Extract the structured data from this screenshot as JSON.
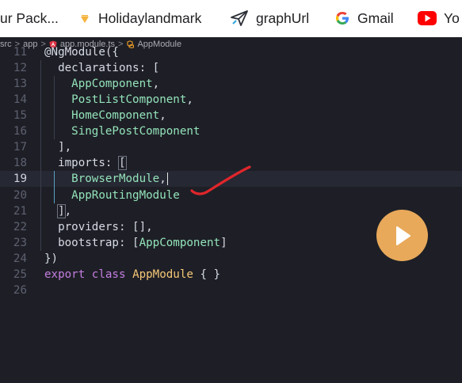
{
  "bookmarks": [
    {
      "label": "ur Pack...",
      "icon": "bookmark-fragment"
    },
    {
      "label": "Holidaylandmark",
      "icon": "holidaylandmark-icon"
    },
    {
      "label": "graphUrl",
      "icon": "paper-plane-icon"
    },
    {
      "label": "Gmail",
      "icon": "google-icon"
    },
    {
      "label": "Yo",
      "icon": "youtube-icon"
    }
  ],
  "breadcrumb": [
    "src",
    "app",
    "app.module.ts",
    "AppModule"
  ],
  "lines": [
    {
      "n": "11",
      "t": [
        [
          "prop",
          "@NgModule({"
        ]
      ]
    },
    {
      "n": "12",
      "t": [
        [
          "prop",
          "  declarations: ["
        ]
      ]
    },
    {
      "n": "13",
      "t": [
        [
          "prop",
          "    "
        ],
        [
          "cls",
          "AppComponent"
        ],
        [
          "prop",
          ","
        ]
      ]
    },
    {
      "n": "14",
      "t": [
        [
          "prop",
          "    "
        ],
        [
          "cls",
          "PostListComponent"
        ],
        [
          "prop",
          ","
        ]
      ]
    },
    {
      "n": "15",
      "t": [
        [
          "prop",
          "    "
        ],
        [
          "cls",
          "HomeComponent"
        ],
        [
          "prop",
          ","
        ]
      ]
    },
    {
      "n": "16",
      "t": [
        [
          "prop",
          "    "
        ],
        [
          "cls",
          "SinglePostComponent"
        ]
      ]
    },
    {
      "n": "17",
      "t": [
        [
          "prop",
          "  ],"
        ]
      ]
    },
    {
      "n": "18",
      "t": [
        [
          "prop",
          "  imports: "
        ],
        [
          "brh",
          "["
        ]
      ]
    },
    {
      "n": "19",
      "t": [
        [
          "prop",
          "    "
        ],
        [
          "cls",
          "BrowserModule"
        ],
        [
          "prop",
          ","
        ],
        [
          "caret",
          ""
        ]
      ]
    },
    {
      "n": "20",
      "t": [
        [
          "prop",
          "    "
        ],
        [
          "cls",
          "AppRoutingModule"
        ]
      ]
    },
    {
      "n": "21",
      "t": [
        [
          "prop",
          "  "
        ],
        [
          "brh",
          "]"
        ],
        [
          "prop",
          ","
        ]
      ]
    },
    {
      "n": "22",
      "t": [
        [
          "prop",
          "  providers: [],"
        ]
      ]
    },
    {
      "n": "23",
      "t": [
        [
          "prop",
          "  bootstrap: ["
        ],
        [
          "cls",
          "AppComponent"
        ],
        [
          "prop",
          "]"
        ]
      ]
    },
    {
      "n": "24",
      "t": [
        [
          "prop",
          "})"
        ]
      ]
    },
    {
      "n": "25",
      "t": [
        [
          "kw",
          "export"
        ],
        [
          "prop",
          " "
        ],
        [
          "kw",
          "class"
        ],
        [
          "prop",
          " "
        ],
        [
          "name",
          "AppModule"
        ],
        [
          "prop",
          " { }"
        ]
      ]
    },
    {
      "n": "26",
      "t": []
    }
  ],
  "current_line": "19",
  "colors": {
    "background": "#1e1f26",
    "class_name": "#93e3ba",
    "keyword": "#c47de0",
    "declaration": "#f5c777",
    "play_button": "#e8a95a",
    "annotation_checkmark": "#e0262b"
  }
}
